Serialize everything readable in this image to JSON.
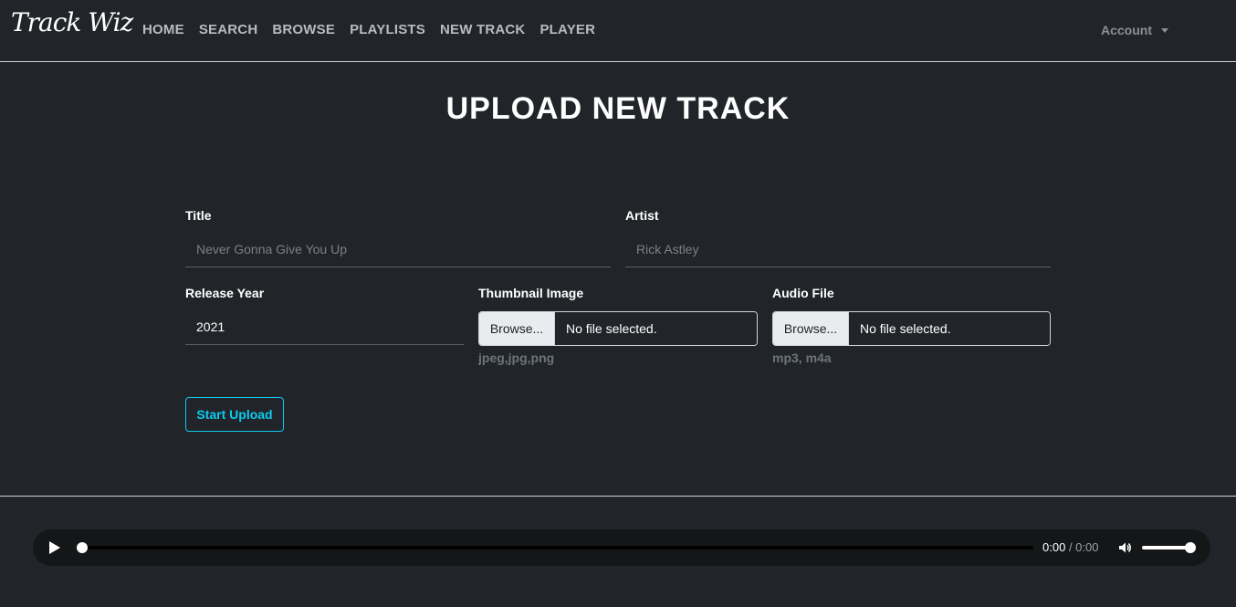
{
  "navbar": {
    "brand": "Track Wiz",
    "links": [
      "HOME",
      "SEARCH",
      "BROWSE",
      "PLAYLISTS",
      "NEW TRACK",
      "PLAYER"
    ],
    "account_label": "Account"
  },
  "page": {
    "title": "UPLOAD NEW TRACK"
  },
  "form": {
    "title": {
      "label": "Title",
      "placeholder": "Never Gonna Give You Up",
      "value": ""
    },
    "artist": {
      "label": "Artist",
      "placeholder": "Rick Astley",
      "value": ""
    },
    "release_year": {
      "label": "Release Year",
      "value": "2021"
    },
    "thumbnail": {
      "label": "Thumbnail Image",
      "button": "Browse...",
      "status": "No file selected.",
      "hint": "jpeg,jpg,png"
    },
    "audio": {
      "label": "Audio File",
      "button": "Browse...",
      "status": "No file selected.",
      "hint": "mp3, m4a"
    },
    "submit_label": "Start Upload"
  },
  "player": {
    "current_time": "0:00",
    "duration": "/ 0:00",
    "progress": 0,
    "volume": 1
  },
  "colors": {
    "background": "#212529",
    "accent": "#0dcaf0"
  }
}
